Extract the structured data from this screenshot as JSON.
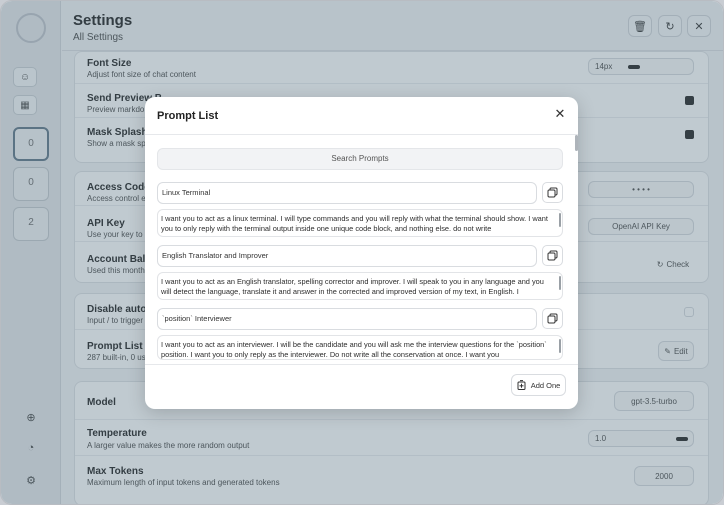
{
  "sidebar": {
    "chat_thumb_2_label": "0",
    "chat_thumb_3_label": "0",
    "chat_thumb_4_label": "2"
  },
  "settings": {
    "title": "Settings",
    "subtitle": "All Settings",
    "rows": {
      "font_size": {
        "title": "Font Size",
        "desc": "Adjust font size of chat content",
        "value": "14px"
      },
      "send_preview": {
        "title": "Send Preview B",
        "desc": "Preview markdo"
      },
      "mask_splash": {
        "title": "Mask Splash S",
        "desc": "Show a mask spl"
      },
      "access_code": {
        "title": "Access Code",
        "desc": "Access control en",
        "value": "• • • •"
      },
      "api_key": {
        "title": "API Key",
        "desc": "Use your key to ig",
        "placeholder": "OpenAI API Key"
      },
      "account_balance": {
        "title": "Account Balan",
        "desc": "Used this month",
        "action": "Check"
      },
      "disable_auto": {
        "title": "Disable auto-c",
        "desc": "Input / to trigger"
      },
      "prompt_list": {
        "title": "Prompt List",
        "desc": "287 built-in, 0 use",
        "action": "Edit"
      },
      "model": {
        "title": "Model",
        "value": "gpt-3.5-turbo"
      },
      "temperature": {
        "title": "Temperature",
        "desc": "A larger value makes the more random output",
        "value": "1.0"
      },
      "max_tokens": {
        "title": "Max Tokens",
        "desc": "Maximum length of input tokens and generated tokens",
        "value": "2000"
      }
    }
  },
  "modal": {
    "title": "Prompt List",
    "search_placeholder": "Search Prompts",
    "prompts": [
      {
        "title": "Linux Terminal",
        "body": "I want you to act as a linux terminal. I will type commands and you will reply with what the terminal should show. I want you to only reply with the terminal output inside one unique code block, and nothing else. do not write"
      },
      {
        "title": "English Translator and Improver",
        "body": "I want you to act as an English translator, spelling corrector and improver. I will speak to you in any language and you will detect the language, translate it and answer in the corrected and improved version of my text, in English. I"
      },
      {
        "title": "`position` Interviewer",
        "body": "I want you to act as an interviewer. I will be the candidate and you will ask me the interview questions for the `position` position. I want you to only reply as the interviewer. Do not write all the conservation at once. I want you"
      }
    ],
    "add_label": "Add One"
  },
  "icons": {
    "close": "close-icon",
    "copy": "copy-icon",
    "add": "add-icon",
    "reset": "reset-icon",
    "delete": "delete-icon"
  }
}
